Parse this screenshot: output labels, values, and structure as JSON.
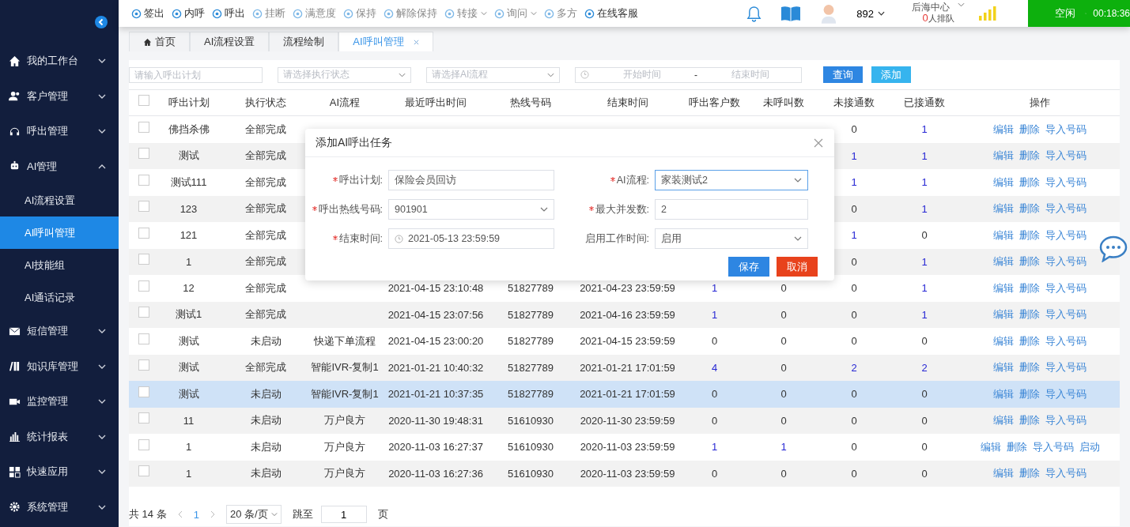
{
  "sidebar": {
    "items": [
      {
        "label": "我的工作台",
        "expanded": false
      },
      {
        "label": "客户管理",
        "expanded": false
      },
      {
        "label": "呼出管理",
        "expanded": false
      },
      {
        "label": "AI管理",
        "expanded": true,
        "children": [
          {
            "label": "AI流程设置",
            "selected": false
          },
          {
            "label": "AI呼叫管理",
            "selected": true
          },
          {
            "label": "AI技能组",
            "selected": false
          },
          {
            "label": "AI通话记录",
            "selected": false
          }
        ]
      },
      {
        "label": "短信管理",
        "expanded": false
      },
      {
        "label": "知识库管理",
        "expanded": false
      },
      {
        "label": "监控管理",
        "expanded": false
      },
      {
        "label": "统计报表",
        "expanded": false
      },
      {
        "label": "快速应用",
        "expanded": false
      },
      {
        "label": "系统管理",
        "expanded": false
      }
    ]
  },
  "toolbar": {
    "items": [
      {
        "label": "签出",
        "disabled": false,
        "has_menu": false
      },
      {
        "label": "内呼",
        "disabled": false,
        "has_menu": false
      },
      {
        "label": "呼出",
        "disabled": false,
        "has_menu": false
      },
      {
        "label": "挂断",
        "disabled": true,
        "has_menu": false
      },
      {
        "label": "满意度",
        "disabled": true,
        "has_menu": false
      },
      {
        "label": "保持",
        "disabled": true,
        "has_menu": false
      },
      {
        "label": "解除保持",
        "disabled": true,
        "has_menu": false
      },
      {
        "label": "转接",
        "disabled": true,
        "has_menu": true
      },
      {
        "label": "询问",
        "disabled": true,
        "has_menu": true
      },
      {
        "label": "多方",
        "disabled": true,
        "has_menu": false
      },
      {
        "label": "在线客服",
        "disabled": false,
        "has_menu": false
      }
    ],
    "extension": "892",
    "group": "后海中心",
    "queue_count": "0",
    "queue_label": "人排队",
    "status": "空闲",
    "timer": "00:18:36"
  },
  "tabs": [
    {
      "label": "首页",
      "selected": false,
      "closable": false
    },
    {
      "label": "AI流程设置",
      "selected": false,
      "closable": false
    },
    {
      "label": "流程绘制",
      "selected": false,
      "closable": false
    },
    {
      "label": "AI呼叫管理",
      "selected": true,
      "closable": true
    }
  ],
  "filters": {
    "plan_placeholder": "请输入呼出计划",
    "status_placeholder": "请选择执行状态",
    "flow_placeholder": "请选择AI流程",
    "start_placeholder": "开始时间",
    "range_separator": "-",
    "end_placeholder": "结束时间",
    "query_button": "查询",
    "add_button": "添加"
  },
  "table": {
    "all_checked": false,
    "columns": [
      "呼出计划",
      "执行状态",
      "AI流程",
      "最近呼出时间",
      "热线号码",
      "结束时间",
      "呼出客户数",
      "未呼叫数",
      "未接通数",
      "已接通数",
      "操作"
    ],
    "rows": [
      {
        "selected": false,
        "checked": false,
        "plan": "佛挡杀佛",
        "status": "全部完成",
        "unanswered": {
          "text": "0",
          "link": false
        },
        "answered": {
          "text": "1",
          "link": true
        },
        "actions": [
          "编辑",
          "删除",
          "导入号码"
        ]
      },
      {
        "selected": false,
        "checked": false,
        "plan": "测试",
        "status": "全部完成",
        "unanswered": {
          "text": "1",
          "link": true
        },
        "answered": {
          "text": "1",
          "link": true
        },
        "actions": [
          "编辑",
          "删除",
          "导入号码"
        ]
      },
      {
        "selected": false,
        "checked": false,
        "plan": "测试111",
        "status": "全部完成",
        "unanswered": {
          "text": "1",
          "link": true
        },
        "answered": {
          "text": "1",
          "link": true
        },
        "actions": [
          "编辑",
          "删除",
          "导入号码"
        ]
      },
      {
        "selected": false,
        "checked": false,
        "plan": "123",
        "status": "全部完成",
        "unanswered": {
          "text": "0",
          "link": false
        },
        "answered": {
          "text": "1",
          "link": true
        },
        "actions": [
          "编辑",
          "删除",
          "导入号码"
        ]
      },
      {
        "selected": false,
        "checked": false,
        "plan": "121",
        "status": "全部完成",
        "unanswered": {
          "text": "1",
          "link": true
        },
        "answered": {
          "text": "0",
          "link": false
        },
        "actions": [
          "编辑",
          "删除",
          "导入号码"
        ]
      },
      {
        "selected": false,
        "checked": false,
        "plan": "1",
        "status": "全部完成",
        "unanswered": {
          "text": "0",
          "link": false
        },
        "answered": {
          "text": "1",
          "link": true
        },
        "actions": [
          "编辑",
          "删除",
          "导入号码"
        ]
      },
      {
        "selected": false,
        "checked": false,
        "plan": "12",
        "status": "全部完成",
        "last_call": "2021-04-15 23:10:48",
        "hotline": "51827789",
        "end_time": "2021-04-23 23:59:59",
        "customers": {
          "text": "1",
          "link": true
        },
        "uncalled": {
          "text": "0",
          "link": false
        },
        "unanswered": {
          "text": "0",
          "link": false
        },
        "answered": {
          "text": "1",
          "link": true
        },
        "actions": [
          "编辑",
          "删除",
          "导入号码"
        ]
      },
      {
        "selected": false,
        "checked": false,
        "plan": "测试1",
        "status": "全部完成",
        "last_call": "2021-04-15 23:07:56",
        "hotline": "51827789",
        "end_time": "2021-04-16 23:59:59",
        "customers": {
          "text": "1",
          "link": true
        },
        "uncalled": {
          "text": "0",
          "link": false
        },
        "unanswered": {
          "text": "0",
          "link": false
        },
        "answered": {
          "text": "1",
          "link": true
        },
        "actions": [
          "编辑",
          "删除",
          "导入号码"
        ]
      },
      {
        "selected": false,
        "checked": false,
        "plan": "测试",
        "status": "未启动",
        "flow": "快递下单流程",
        "last_call": "2021-04-15 23:00:20",
        "hotline": "51827789",
        "end_time": "2021-04-15 23:59:59",
        "customers": {
          "text": "0",
          "link": false
        },
        "uncalled": {
          "text": "0",
          "link": false
        },
        "unanswered": {
          "text": "0",
          "link": false
        },
        "answered": {
          "text": "0",
          "link": false
        },
        "actions": [
          "编辑",
          "删除",
          "导入号码"
        ]
      },
      {
        "selected": false,
        "checked": false,
        "plan": "测试",
        "status": "全部完成",
        "flow": "智能IVR-复制1",
        "last_call": "2021-01-21 10:40:32",
        "hotline": "51827789",
        "end_time": "2021-01-21 17:01:59",
        "customers": {
          "text": "4",
          "link": true
        },
        "uncalled": {
          "text": "0",
          "link": false
        },
        "unanswered": {
          "text": "2",
          "link": true
        },
        "answered": {
          "text": "2",
          "link": true
        },
        "actions": [
          "编辑",
          "删除",
          "导入号码"
        ]
      },
      {
        "selected": true,
        "checked": false,
        "plan": "测试",
        "status": "未启动",
        "flow": "智能IVR-复制1",
        "last_call": "2021-01-21 10:37:35",
        "hotline": "51827789",
        "end_time": "2021-01-21 17:01:59",
        "customers": {
          "text": "0",
          "link": false
        },
        "uncalled": {
          "text": "0",
          "link": false
        },
        "unanswered": {
          "text": "0",
          "link": false
        },
        "answered": {
          "text": "0",
          "link": false
        },
        "actions": [
          "编辑",
          "删除",
          "导入号码"
        ]
      },
      {
        "selected": false,
        "checked": false,
        "plan": "11",
        "status": "未启动",
        "flow": "万户良方",
        "last_call": "2020-11-30 19:48:31",
        "hotline": "51610930",
        "end_time": "2020-11-30 23:59:59",
        "customers": {
          "text": "0",
          "link": false
        },
        "uncalled": {
          "text": "0",
          "link": false
        },
        "unanswered": {
          "text": "0",
          "link": false
        },
        "answered": {
          "text": "0",
          "link": false
        },
        "actions": [
          "编辑",
          "删除",
          "导入号码"
        ]
      },
      {
        "selected": false,
        "checked": false,
        "plan": "1",
        "status": "未启动",
        "flow": "万户良方",
        "last_call": "2020-11-03 16:27:37",
        "hotline": "51610930",
        "end_time": "2020-11-03 23:59:59",
        "customers": {
          "text": "1",
          "link": true
        },
        "uncalled": {
          "text": "1",
          "link": true
        },
        "unanswered": {
          "text": "0",
          "link": false
        },
        "answered": {
          "text": "0",
          "link": false
        },
        "actions": [
          "编辑",
          "删除",
          "导入号码",
          "启动"
        ]
      },
      {
        "selected": false,
        "checked": false,
        "plan": "1",
        "status": "未启动",
        "flow": "万户良方",
        "last_call": "2020-11-03 16:27:36",
        "hotline": "51610930",
        "end_time": "2020-11-03 23:59:59",
        "customers": {
          "text": "0",
          "link": false
        },
        "uncalled": {
          "text": "0",
          "link": false
        },
        "unanswered": {
          "text": "0",
          "link": false
        },
        "answered": {
          "text": "0",
          "link": false
        },
        "actions": [
          "编辑",
          "删除",
          "导入号码"
        ]
      }
    ]
  },
  "pagination": {
    "total": "共 14 条",
    "current_page": "1",
    "page_size": "20 条/页",
    "jump_label": "跳至",
    "jump_value": "1",
    "page_unit": "页"
  },
  "dialog": {
    "title": "添加AI呼出任务",
    "fields": [
      {
        "label": "呼出计划:",
        "kind": "input",
        "required": true,
        "value": "保险会员回访",
        "focused": false
      },
      {
        "label": "AI流程:",
        "kind": "select",
        "required": true,
        "value": "家装测试2",
        "focused": true
      },
      {
        "label": "呼出热线号码:",
        "kind": "select",
        "required": true,
        "value": "901901",
        "focused": false
      },
      {
        "label": "最大并发数:",
        "kind": "input",
        "required": true,
        "value": "2",
        "focused": false
      },
      {
        "label": "结束时间:",
        "kind": "date",
        "required": true,
        "value": "2021-05-13 23:59:59",
        "focused": false
      },
      {
        "label": "启用工作时间:",
        "kind": "select",
        "required": false,
        "value": "启用",
        "focused": false
      }
    ],
    "save_button": "保存",
    "cancel_button": "取消"
  }
}
